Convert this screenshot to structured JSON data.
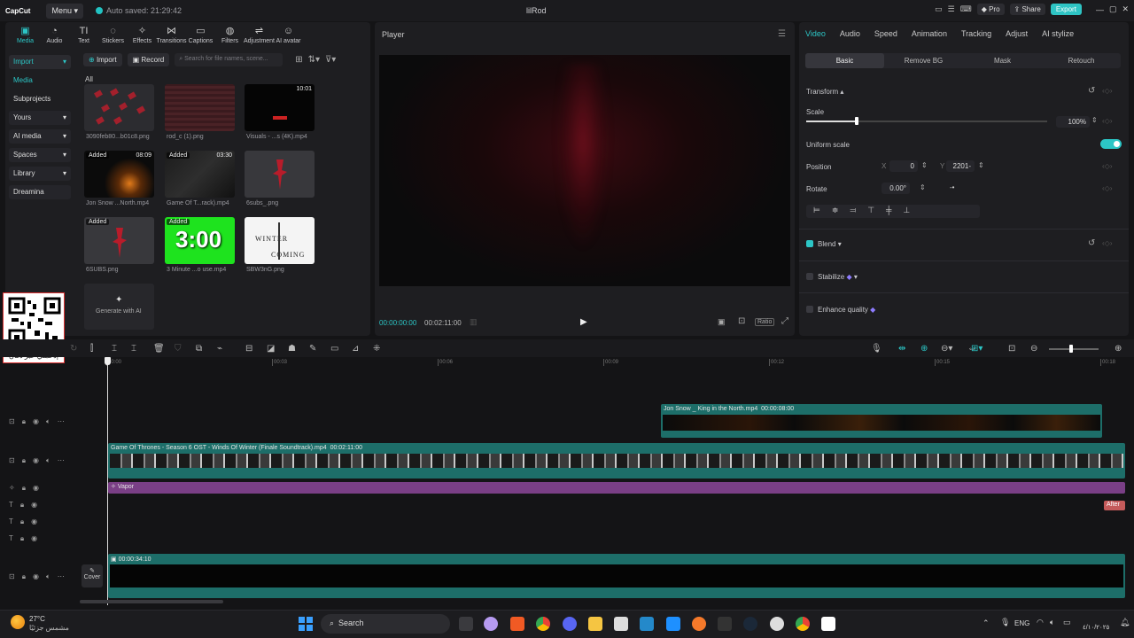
{
  "topbar": {
    "logo": "CapCut",
    "menu_label": "Menu",
    "autosave": "Auto saved: 21:29:42",
    "project_title": "lilRod",
    "pro_label": "Pro",
    "share_label": "Share",
    "export_label": "Export"
  },
  "media_toolbar": [
    {
      "label": "Media",
      "icon": "media-icon"
    },
    {
      "label": "Audio",
      "icon": "audio-icon"
    },
    {
      "label": "Text",
      "icon": "text-icon"
    },
    {
      "label": "Stickers",
      "icon": "stickers-icon"
    },
    {
      "label": "Effects",
      "icon": "effects-icon"
    },
    {
      "label": "Transitions",
      "icon": "transitions-icon"
    },
    {
      "label": "Captions",
      "icon": "captions-icon"
    },
    {
      "label": "Filters",
      "icon": "filters-icon"
    },
    {
      "label": "Adjustment",
      "icon": "adjustment-icon"
    },
    {
      "label": "AI avatar",
      "icon": "ai-avatar-icon"
    }
  ],
  "sidenav": [
    {
      "label": "Import",
      "chev": "▾"
    },
    {
      "label": "Media",
      "chev": ""
    },
    {
      "label": "Subprojects",
      "chev": ""
    },
    {
      "label": "Yours",
      "chev": "▾"
    },
    {
      "label": "AI media",
      "chev": "▾"
    },
    {
      "label": "Spaces",
      "chev": "▾"
    },
    {
      "label": "Library",
      "chev": "▾"
    },
    {
      "label": "Dreamina",
      "chev": ""
    }
  ],
  "media": {
    "import_label": "Import",
    "record_label": "Record",
    "search_placeholder": "Search for file names, scene...",
    "filter_all": "All",
    "items": [
      {
        "name": "3090feb80...b01c8.png",
        "badge": "",
        "duration": ""
      },
      {
        "name": "rod_c (1).png",
        "badge": "",
        "duration": ""
      },
      {
        "name": "Visuals - ...s (4K).mp4",
        "badge": "",
        "duration": "10:01"
      },
      {
        "name": "Jon Snow ...North.mp4",
        "badge": "Added",
        "duration": "08:09"
      },
      {
        "name": "Game Of T...rack).mp4",
        "badge": "Added",
        "duration": "03:30"
      },
      {
        "name": "6subs_.png",
        "badge": "",
        "duration": ""
      },
      {
        "name": "6SUBS.png",
        "badge": "Added",
        "duration": ""
      },
      {
        "name": "3 Minute ...o use.mp4",
        "badge": "Added",
        "duration": ""
      },
      {
        "name": "SBW3nG.png",
        "badge": "",
        "duration": ""
      }
    ],
    "countdown_text": "3:00",
    "winter_top": "WINTER",
    "winter_bottom": "COMING",
    "generate_label": "Generate with AI"
  },
  "qr": {
    "caption": "إدعمني عبر دكان"
  },
  "player": {
    "title": "Player",
    "current_time": "00:00:00:00",
    "total_time": "00:02:11:00",
    "ratio_label": "Ratio"
  },
  "inspector": {
    "tabs": [
      "Video",
      "Audio",
      "Speed",
      "Animation",
      "Tracking",
      "Adjust",
      "AI stylize"
    ],
    "subtabs": [
      "Basic",
      "Remove BG",
      "Mask",
      "Retouch"
    ],
    "transform_label": "Transform",
    "scale_label": "Scale",
    "scale_value": "100%",
    "scale_fraction": 0.21,
    "uniform_scale_label": "Uniform scale",
    "position_label": "Position",
    "x_label": "X",
    "x_value": "0",
    "y_label": "Y",
    "y_value": "2201-",
    "rotate_label": "Rotate",
    "rotate_value": "0.00°",
    "blend_label": "Blend",
    "stabilize_label": "Stabilize",
    "enhance_label": "Enhance quality"
  },
  "timeline": {
    "ruler": [
      "00:00",
      "00:03",
      "00:06",
      "00:09",
      "00:12",
      "00:15",
      "00:18"
    ],
    "clip_jon": {
      "name": "Jon Snow _ King in the North.mp4",
      "time": "00:00:08:00"
    },
    "clip_got": {
      "name": "Game Of Thrones - Season 6 OST - Winds Of Winter (Finale Soundtrack).mp4",
      "time": "00:02:11:00"
    },
    "clip_vapor": "Vapor",
    "after_tag": "After",
    "audio_time": "00:00:34:10",
    "cover_label": "Cover"
  },
  "taskbar": {
    "temperature": "27°C",
    "weather": "مشمس جزئيًا",
    "search_label": "Search",
    "lang": "ENG",
    "date": "٤/١٠/٢٠٢٥"
  },
  "colors": {
    "accent": "#2cc6c6",
    "clip_teal": "#1e7a75",
    "clip_purple": "#7a3f86"
  }
}
